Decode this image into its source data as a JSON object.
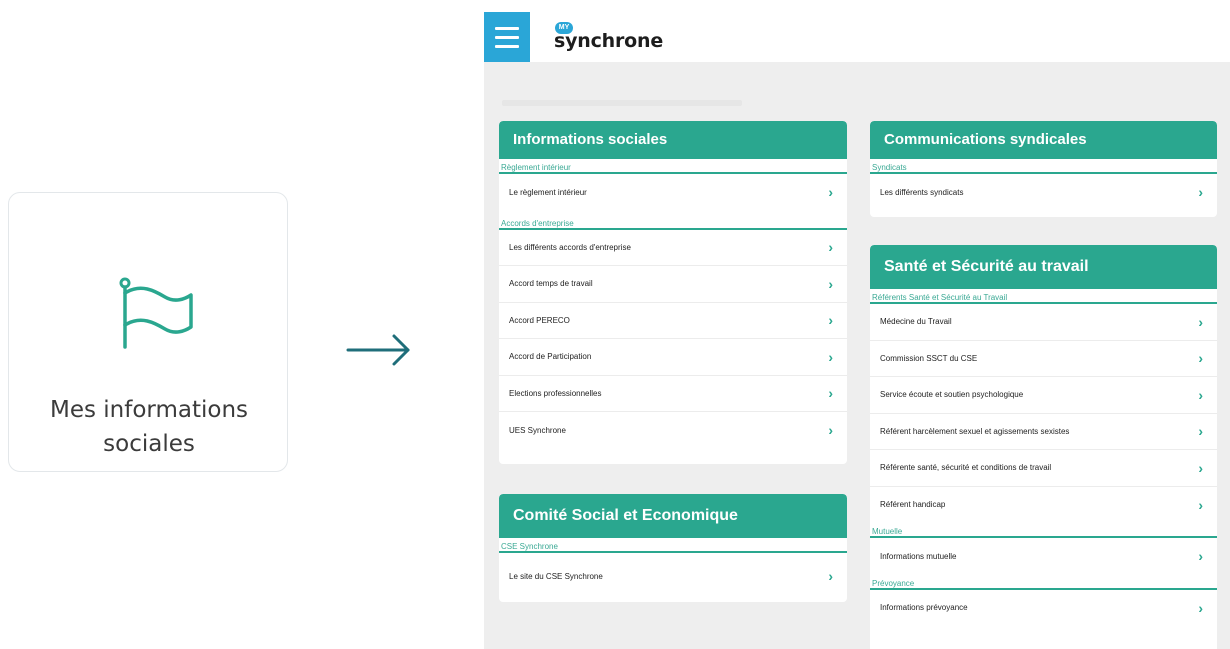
{
  "tile": {
    "icon": "flag-icon",
    "label_line1": "Mes informations",
    "label_line2": "sociales"
  },
  "arrow": {
    "icon": "arrow-right-icon"
  },
  "app": {
    "logo_badge": "MY",
    "logo_text": "synchrone",
    "menu_icon": "hamburger-icon"
  },
  "colors": {
    "accent": "#2aa78f",
    "menu": "#2aa6d7",
    "background": "#eeeeee"
  },
  "cards": {
    "informations_sociales": {
      "title": "Informations sociales",
      "section1": "Règlement intérieur",
      "section1_items": [
        "Le règlement intérieur"
      ],
      "section2": "Accords d'entreprise",
      "section2_items": [
        "Les différents accords d'entreprise",
        "Accord temps de travail",
        "Accord PERECO",
        "Accord de Participation",
        "Elections professionnelles",
        "UES Synchrone"
      ]
    },
    "cse": {
      "title": "Comité Social et Economique",
      "section1": "CSE Synchrone",
      "section1_items": [
        "Le site du CSE Synchrone"
      ]
    },
    "communications": {
      "title": "Communications syndicales",
      "section1": "Syndicats",
      "section1_items": [
        "Les différents syndicats"
      ]
    },
    "sante": {
      "title": "Santé et Sécurité au travail",
      "section1": "Référents Santé et Sécurité au Travail",
      "section1_items": [
        "Médecine du Travail",
        "Commission SSCT du CSE",
        "Service écoute et soutien psychologique",
        "Référent harcèlement sexuel et agissements sexistes",
        "Référente santé, sécurité et conditions de travail",
        "Référent handicap"
      ],
      "section2": "Mutuelle",
      "section2_items": [
        "Informations mutuelle"
      ],
      "section3": "Prévoyance",
      "section3_items": [
        "Informations prévoyance"
      ]
    }
  },
  "chevron": "›"
}
